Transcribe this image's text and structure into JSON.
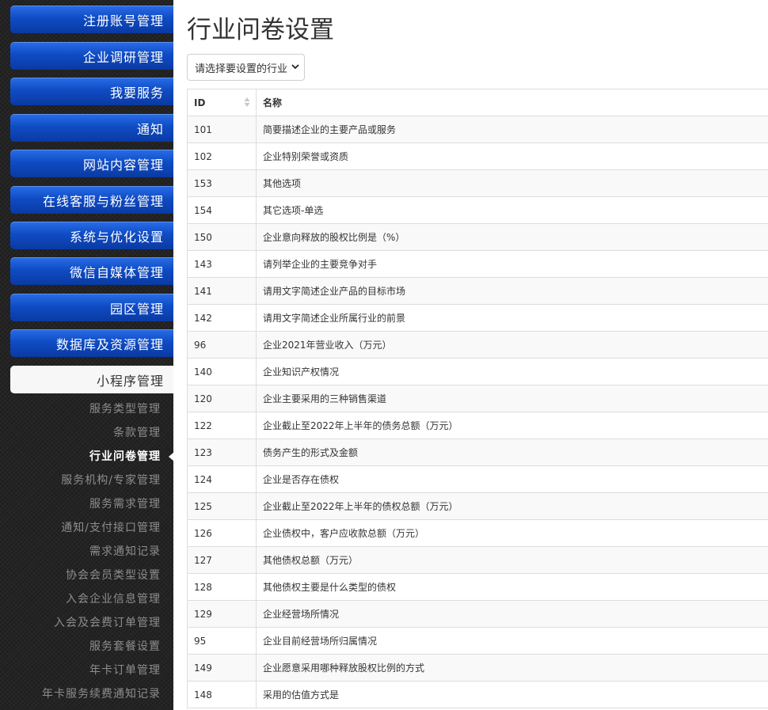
{
  "sidebar": {
    "menus": [
      {
        "label": "注册账号管理"
      },
      {
        "label": "企业调研管理"
      },
      {
        "label": "我要服务"
      },
      {
        "label": "通知"
      },
      {
        "label": "网站内容管理"
      },
      {
        "label": "在线客服与粉丝管理"
      },
      {
        "label": "系统与优化设置"
      },
      {
        "label": "微信自媒体管理"
      },
      {
        "label": "园区管理"
      },
      {
        "label": "数据库及资源管理"
      },
      {
        "label": "小程序管理"
      }
    ],
    "sub_items": [
      {
        "label": "服务类型管理"
      },
      {
        "label": "条款管理"
      },
      {
        "label": "行业问卷管理"
      },
      {
        "label": "服务机构/专家管理"
      },
      {
        "label": "服务需求管理"
      },
      {
        "label": "通知/支付接口管理"
      },
      {
        "label": "需求通知记录"
      },
      {
        "label": "协会会员类型设置"
      },
      {
        "label": "入会企业信息管理"
      },
      {
        "label": "入会及会费订单管理"
      },
      {
        "label": "服务套餐设置"
      },
      {
        "label": "年卡订单管理"
      },
      {
        "label": "年卡服务续费通知记录"
      }
    ],
    "active_menu": "小程序管理",
    "active_sub": "行业问卷管理"
  },
  "main": {
    "title": "行业问卷设置",
    "select": {
      "selected": "请选择要设置的行业"
    },
    "table": {
      "headers": [
        "ID",
        "名称"
      ],
      "rows": [
        [
          "101",
          "简要描述企业的主要产品或服务"
        ],
        [
          "102",
          "企业特别荣誉或资质"
        ],
        [
          "153",
          "其他选项"
        ],
        [
          "154",
          "其它选项-单选"
        ],
        [
          "150",
          "企业意向释放的股权比例是（%）"
        ],
        [
          "143",
          "请列举企业的主要竞争对手"
        ],
        [
          "141",
          "请用文字简述企业产品的目标市场"
        ],
        [
          "142",
          "请用文字简述企业所属行业的前景"
        ],
        [
          "96",
          "企业2021年营业收入（万元）"
        ],
        [
          "140",
          "企业知识产权情况"
        ],
        [
          "120",
          "企业主要采用的三种销售渠道"
        ],
        [
          "122",
          "企业截止至2022年上半年的债务总额（万元）"
        ],
        [
          "123",
          "债务产生的形式及金额"
        ],
        [
          "124",
          "企业是否存在债权"
        ],
        [
          "125",
          "企业截止至2022年上半年的债权总额（万元）"
        ],
        [
          "126",
          "企业债权中，客户应收款总额（万元）"
        ],
        [
          "127",
          "其他债权总额（万元）"
        ],
        [
          "128",
          "其他债权主要是什么类型的债权"
        ],
        [
          "129",
          "企业经营场所情况"
        ],
        [
          "95",
          "企业目前经营场所归属情况"
        ],
        [
          "149",
          "企业愿意采用哪种释放股权比例的方式"
        ],
        [
          "148",
          "采用的估值方式是"
        ]
      ]
    }
  },
  "colors": {
    "menu_blue": "#0f4cc4",
    "sidebar_bg": "#242424",
    "active_menu_bg": "#f7f7f7",
    "sub_item_text": "#8d8d8d"
  },
  "icons": {
    "select_arrow": "chevron-down-icon",
    "sort": "sort-icon",
    "active_pointer": "caret-left-icon"
  }
}
